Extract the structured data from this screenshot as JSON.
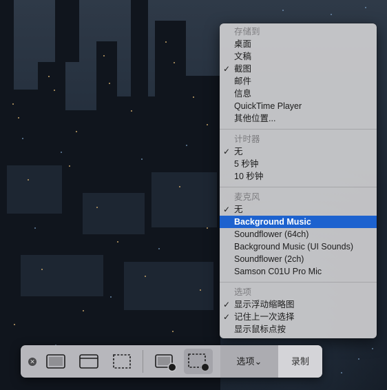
{
  "menu": {
    "save_to": {
      "header": "存储到",
      "items": [
        {
          "label": "桌面",
          "checked": false
        },
        {
          "label": "文稿",
          "checked": false
        },
        {
          "label": "截图",
          "checked": true
        },
        {
          "label": "邮件",
          "checked": false
        },
        {
          "label": "信息",
          "checked": false
        },
        {
          "label": "QuickTime Player",
          "checked": false
        },
        {
          "label": "其他位置...",
          "checked": false
        }
      ]
    },
    "timer": {
      "header": "计时器",
      "items": [
        {
          "label": "无",
          "checked": true
        },
        {
          "label": "5 秒钟",
          "checked": false
        },
        {
          "label": "10 秒钟",
          "checked": false
        }
      ]
    },
    "microphone": {
      "header": "麦克风",
      "items": [
        {
          "label": "无",
          "checked": true
        },
        {
          "label": "Background Music",
          "checked": false,
          "highlighted": true
        },
        {
          "label": "Soundflower (64ch)",
          "checked": false
        },
        {
          "label": "Background Music (UI Sounds)",
          "checked": false
        },
        {
          "label": "Soundflower (2ch)",
          "checked": false
        },
        {
          "label": "Samson C01U Pro Mic",
          "checked": false
        }
      ]
    },
    "options": {
      "header": "选项",
      "items": [
        {
          "label": "显示浮动缩略图",
          "checked": true
        },
        {
          "label": "记住上一次选择",
          "checked": true
        },
        {
          "label": "显示鼠标点按",
          "checked": false
        }
      ]
    },
    "check_mark": "✓",
    "highlight_color": "#1d62cf"
  },
  "toolbar": {
    "close_glyph": "✕",
    "options_label": "选项",
    "options_chevron": "⌄",
    "record_label": "录制",
    "icons": [
      "capture-entire-screen-icon",
      "capture-window-icon",
      "capture-selection-icon",
      "record-entire-screen-icon",
      "record-selection-icon"
    ]
  }
}
